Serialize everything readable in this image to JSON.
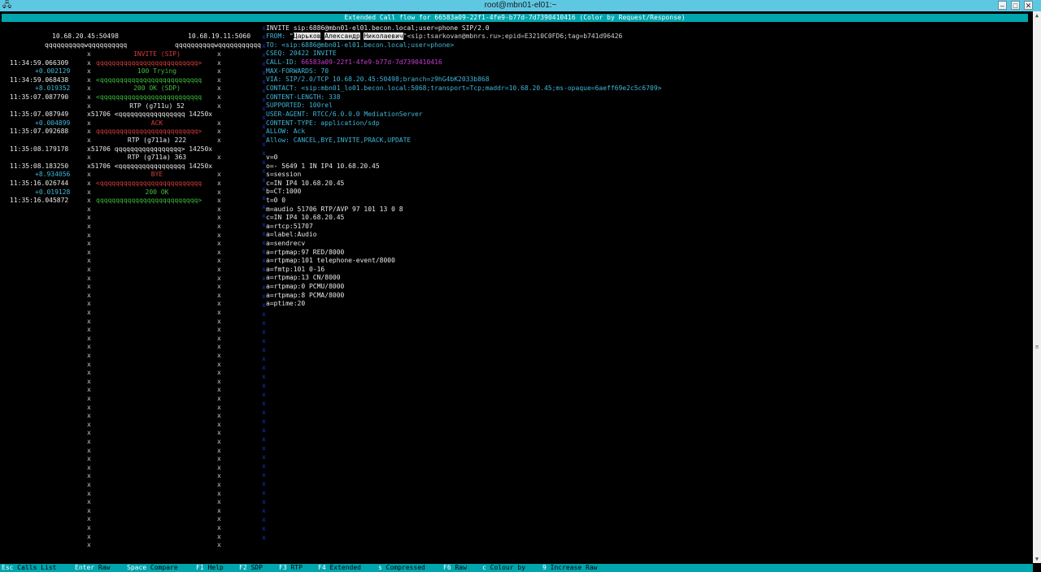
{
  "window": {
    "title": "root@mbn01-el01:~",
    "icon": "putty-icon"
  },
  "header": {
    "title": "Extended Call flow for 66583a09-22f1-4fe9-b77d-7d7390410416 (Color by Request/Response)"
  },
  "flow": {
    "host_left": "10.68.20.45:50498",
    "host_right": "10.68.19.11:5060",
    "q_left": "qqqqqqqqqqwqqqqqqqqqq",
    "q_right": "qqqqqqqqqqwqqqqqqqqqqq",
    "rows": [
      {
        "time": "",
        "delta": "",
        "arrow": "INVITE (SIP)",
        "cls": "red"
      },
      {
        "time": "11:34:59.066309",
        "delta": "",
        "arrow": "qqqqqqqqqqqqqqqqqqqqqqqqqq>",
        "cls": "red"
      },
      {
        "time": "",
        "delta": "+0.002129",
        "arrow": "100 Trying",
        "cls": "grn"
      },
      {
        "time": "11:34:59.068438",
        "delta": "",
        "arrow": "<qqqqqqqqqqqqqqqqqqqqqqqqqq",
        "cls": "grn"
      },
      {
        "time": "",
        "delta": "+8.019352",
        "arrow": "200 OK (SDP)",
        "cls": "grn"
      },
      {
        "time": "11:35:07.087790",
        "delta": "",
        "arrow": "<qqqqqqqqqqqqqqqqqqqqqqqqqq",
        "cls": "grn"
      },
      {
        "time": "",
        "delta": "",
        "arrow": "RTP (g711u) 52",
        "cls": "w"
      },
      {
        "time": "11:35:07.087949",
        "delta": "",
        "arrow": "x51706 <qqqqqqqqqqqqqqqqq 14250x",
        "cls": "w"
      },
      {
        "time": "",
        "delta": "+0.004899",
        "arrow": "ACK",
        "cls": "red"
      },
      {
        "time": "11:35:07.092688",
        "delta": "",
        "arrow": "qqqqqqqqqqqqqqqqqqqqqqqqqq>",
        "cls": "red"
      },
      {
        "time": "",
        "delta": "",
        "arrow": "RTP (g711a) 222",
        "cls": "w"
      },
      {
        "time": "11:35:08.179178",
        "delta": "",
        "arrow": "x51706 qqqqqqqqqqqqqqqqq> 14250x",
        "cls": "w"
      },
      {
        "time": "",
        "delta": "",
        "arrow": "RTP (g711a) 363",
        "cls": "w"
      },
      {
        "time": "11:35:08.183250",
        "delta": "",
        "arrow": "x51706 <qqqqqqqqqqqqqqqqq 14250x",
        "cls": "w"
      },
      {
        "time": "",
        "delta": "+8.934056",
        "arrow": "BYE",
        "cls": "red"
      },
      {
        "time": "11:35:16.026744",
        "delta": "",
        "arrow": "<qqqqqqqqqqqqqqqqqqqqqqqqqq",
        "cls": "red"
      },
      {
        "time": "",
        "delta": "+0.019128",
        "arrow": "200 OK",
        "cls": "grn"
      },
      {
        "time": "11:35:16.045872",
        "delta": "",
        "arrow": "qqqqqqqqqqqqqqqqqqqqqqqqqq>",
        "cls": "grn"
      }
    ]
  },
  "sip": {
    "line1": "INVITE sip:6886@mbn01-el01.becon.local;user=phone SIP/2.0",
    "from_label": "FROM:",
    "from_q": "\"",
    "from_n1": "Царьков",
    "from_n2": "Александр",
    "from_n3": "Николаевич",
    "from_rest": "\"<sip:tsarkovan@mbnrs.ru>;epid=E3210C0FD6;tag=b741d96426",
    "to": "TO: <sip:6886@mbn01-el01.becon.local;user=phone>",
    "cseq": "CSEQ: 20422 INVITE",
    "callid_label": "CALL-ID:",
    "callid_value": "66583a09-22f1-4fe9-b77d-7d7390410416",
    "maxfwd": "MAX-FORWARDS: 70",
    "via": "VIA: SIP/2.0/TCP 10.68.20.45:50498;branch=z9hG4bK2033b868",
    "contact": "CONTACT: <sip:mbn01_lo01.becon.local:5068;transport=Tcp;maddr=10.68.20.45;ms-opaque=6aeff69e2c5c6709>",
    "clen": "CONTENT-LENGTH: 338",
    "supported": "SUPPORTED: 100rel",
    "ua": "USER-AGENT: RTCC/6.0.0.0 MediationServer",
    "ctype": "CONTENT-TYPE: application/sdp",
    "allow1": "ALLOW: Ack",
    "allow2": "Allow: CANCEL,BYE,INVITE,PRACK,UPDATE",
    "sdp": [
      "v=0",
      "o=- 5649 1 IN IP4 10.68.20.45",
      "s=session",
      "c=IN IP4 10.68.20.45",
      "b=CT:1000",
      "t=0 0",
      "m=audio 51706 RTP/AVP 97 101 13 0 8",
      "c=IN IP4 10.68.20.45",
      "a=rtcp:51707",
      "a=label:Audio",
      "a=sendrecv",
      "a=rtpmap:97 RED/8000",
      "a=rtpmap:101 telephone-event/8000",
      "a=fmtp:101 0-16",
      "a=rtpmap:13 CN/8000",
      "a=rtpmap:0 PCMU/8000",
      "a=rtpmap:8 PCMA/8000",
      "a=ptime:20"
    ]
  },
  "footer": [
    {
      "key": "Esc",
      "label": "Calls List"
    },
    {
      "key": "Enter",
      "label": "Raw"
    },
    {
      "key": "Space",
      "label": "Compare"
    },
    {
      "key": "F1",
      "label": "Help"
    },
    {
      "key": "F2",
      "label": "SDP"
    },
    {
      "key": "F3",
      "label": "RTP"
    },
    {
      "key": "F4",
      "label": "Extended"
    },
    {
      "key": "s",
      "label": "Compressed"
    },
    {
      "key": "F6",
      "label": "Raw"
    },
    {
      "key": "c",
      "label": "Colour by"
    },
    {
      "key": "9",
      "label": "Increase Raw"
    }
  ],
  "col_char": "x",
  "sep_char": "x"
}
